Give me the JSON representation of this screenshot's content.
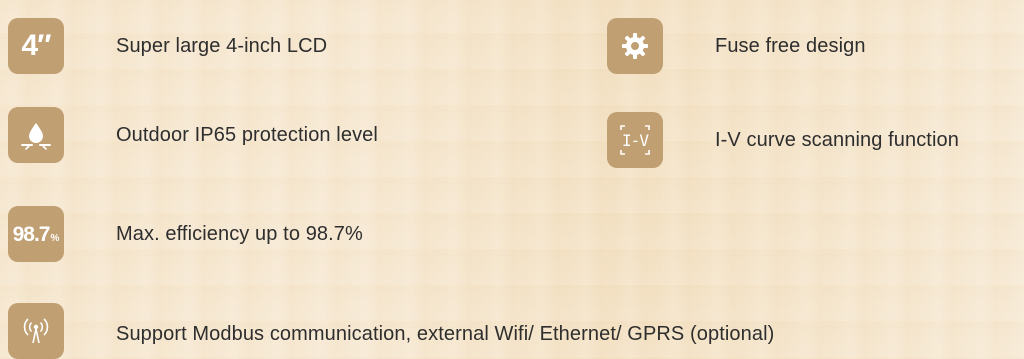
{
  "features": [
    {
      "id": "lcd",
      "icon": "4-inch-icon",
      "icon_text": "4″",
      "label": "Super large 4-inch LCD"
    },
    {
      "id": "fuse",
      "icon": "gear-icon",
      "label": "Fuse free design"
    },
    {
      "id": "ip65",
      "icon": "water-drop-icon",
      "label": "Outdoor IP65 protection level"
    },
    {
      "id": "iv",
      "icon": "iv-curve-icon",
      "icon_text": "I-V",
      "label": "I-V curve scanning function"
    },
    {
      "id": "efficiency",
      "icon": "efficiency-icon",
      "icon_value": "98.7",
      "icon_unit": "%",
      "label": "Max. efficiency up to 98.7%"
    },
    {
      "id": "comm",
      "icon": "antenna-icon",
      "label": "Support Modbus communication, external Wifi/ Ethernet/ GPRS (optional)"
    }
  ],
  "colors": {
    "tile": "#c09f73",
    "text": "#2e2e2e",
    "background": "#f6e7cf"
  }
}
